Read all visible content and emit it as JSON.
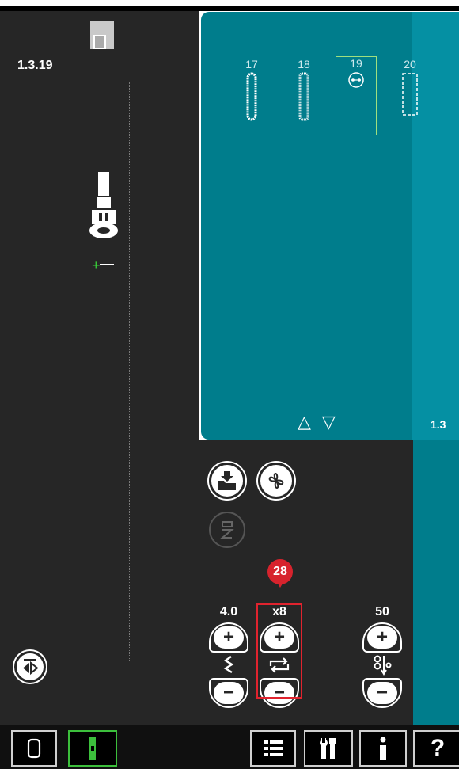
{
  "screen": {
    "path_label": "1.3.19",
    "menu_number": "1.3",
    "annotation_badge": "28"
  },
  "stitches": [
    {
      "number": "17",
      "icon": "buttonhole-round-icon"
    },
    {
      "number": "18",
      "icon": "buttonhole-satin-icon"
    },
    {
      "number": "19",
      "icon": "button-sew-on-icon",
      "selected": true
    },
    {
      "number": "20",
      "icon": "buttonhole-outline-icon"
    }
  ],
  "scroll": {
    "up_symbol": "△",
    "down_symbol": "▽"
  },
  "controls": {
    "stitch_width": {
      "value": "4.0",
      "plus": "+",
      "minus": "−"
    },
    "repeat": {
      "value": "x8",
      "plus": "+",
      "minus": "−"
    },
    "tension": {
      "value": "50",
      "plus": "+",
      "minus": "−"
    }
  },
  "colors": {
    "teal": "#007d8c",
    "dark": "#262626",
    "highlight": "#e0232e",
    "selected_border": "#9fe07f",
    "active_green": "#3cbf3c"
  },
  "toolbar": {
    "buttons": [
      {
        "name": "embroidery-mode-button",
        "icon": "hoop-icon",
        "label": "▢"
      },
      {
        "name": "sewing-mode-button",
        "icon": "presser-foot-icon",
        "label": "▮",
        "active": true
      },
      {
        "name": "selection-menu-button",
        "icon": "list-icon",
        "label": "≣"
      },
      {
        "name": "settings-menu-button",
        "icon": "tools-icon",
        "label": "✂"
      },
      {
        "name": "info-button",
        "icon": "info-icon",
        "label": "i"
      },
      {
        "name": "help-button",
        "icon": "question-icon",
        "label": "?"
      }
    ]
  }
}
